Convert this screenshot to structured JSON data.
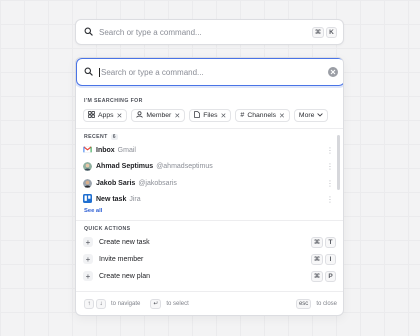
{
  "top_search": {
    "placeholder": "Search or type a command...",
    "shortcut": [
      "⌘",
      "K"
    ]
  },
  "panel": {
    "search_placeholder": "Search or type a command...",
    "searching_for_label": "I'M SEARCHING FOR",
    "chips": [
      {
        "icon": "grid-icon",
        "label": "Apps"
      },
      {
        "icon": "user-icon",
        "label": "Member"
      },
      {
        "icon": "file-icon",
        "label": "Files"
      },
      {
        "icon": "hash-icon",
        "label": "Channels"
      }
    ],
    "more_label": "More",
    "recent_label": "RECENT",
    "recent_count": "6",
    "recent_items": [
      {
        "name": "Inbox",
        "sub": "Gmail",
        "icon": "gmail-icon"
      },
      {
        "name": "Ahmad Septimus",
        "sub": "@ahmadseptimus",
        "icon": "avatar"
      },
      {
        "name": "Jakob Saris",
        "sub": "@jakobsaris",
        "icon": "avatar"
      },
      {
        "name": "New task",
        "sub": "Jira",
        "icon": "trello-icon"
      }
    ],
    "see_all": "See all",
    "quick_actions_label": "QUICK ACTIONS",
    "quick_actions": [
      {
        "label": "Create new task",
        "keys": [
          "⌘",
          "T"
        ]
      },
      {
        "label": "Invite member",
        "keys": [
          "⌘",
          "I"
        ]
      },
      {
        "label": "Create new plan",
        "keys": [
          "⌘",
          "P"
        ]
      }
    ],
    "footer": {
      "navigate_keys": [
        "↑",
        "↓"
      ],
      "navigate_label": "to navigate",
      "select_key": "↵",
      "select_label": "to select",
      "close_key": "esc",
      "close_label": "to close"
    }
  },
  "colors": {
    "accent": "#4a74e6",
    "link": "#2e5fd4",
    "trello": "#1f6fd1",
    "gmail_red": "#ea4335"
  }
}
